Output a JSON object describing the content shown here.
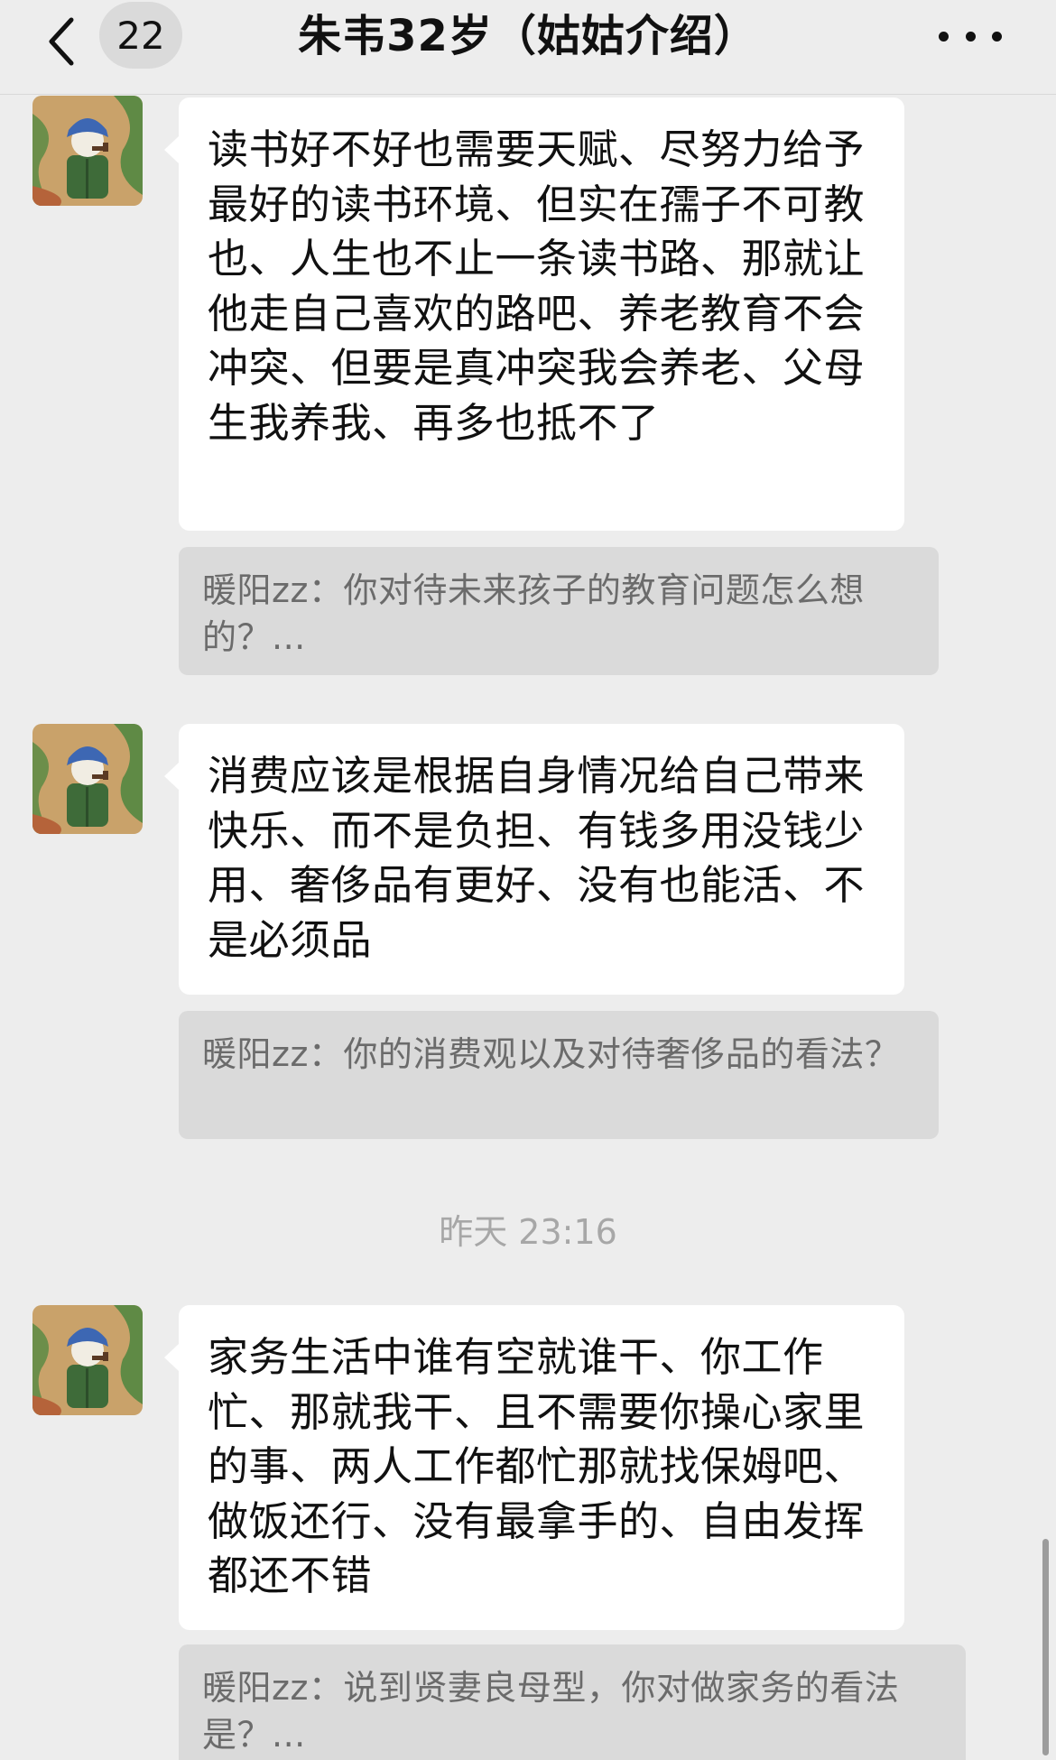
{
  "header": {
    "title": "朱韦32岁（姑姑介绍）",
    "unread_count": "22"
  },
  "messages": [
    {
      "text": "读书好不好也需要天赋、尽努力给予最好的读书环境、但实在孺子不可教也、人生也不止一条读书路、那就让他走自己喜欢的路吧、养老教育不会冲突、但要是真冲突我会养老、父母生我养我、再多也抵不了",
      "quote": "暖阳zz：你对待未来孩子的教育问题怎么想的？..."
    },
    {
      "text": "消费应该是根据自身情况给自己带来快乐、而不是负担、有钱多用没钱少用、奢侈品有更好、没有也能活、不是必须品",
      "quote": "暖阳zz：你的消费观以及对待奢侈品的看法？"
    },
    {
      "text": "家务生活中谁有空就谁干、你工作忙、那就我干、且不需要你操心家里的事、两人工作都忙那就找保姆吧、做饭还行、没有最拿手的、自由发挥都还不错",
      "quote": "暖阳zz：说到贤妻良母型，你对做家务的看法是？..."
    }
  ],
  "timestamp": "昨天 23:16",
  "icons": {
    "back": "chevron-left-icon",
    "more": "more-dots-icon"
  }
}
